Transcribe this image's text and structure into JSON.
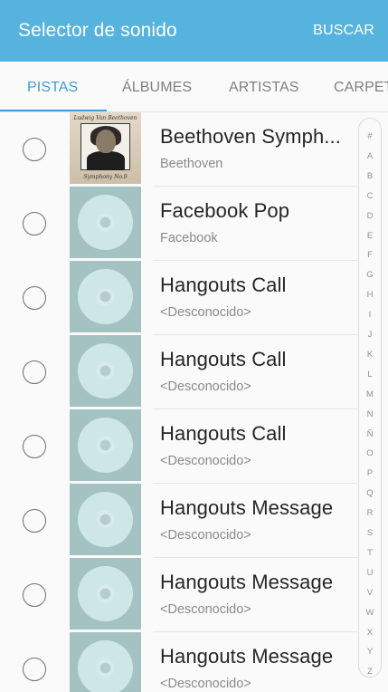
{
  "header": {
    "title": "Selector de sonido",
    "action_label": "BUSCAR"
  },
  "colors": {
    "appbar": "#55b3de",
    "accent": "#3d9dd0"
  },
  "tabs": [
    {
      "label": "PISTAS",
      "active": true
    },
    {
      "label": "ÁLBUMES",
      "active": false
    },
    {
      "label": "ARTISTAS",
      "active": false
    },
    {
      "label": "CARPET",
      "active": false
    }
  ],
  "tracks": [
    {
      "title": "Beethoven Symph...",
      "subtitle": "Beethoven",
      "art": "beethoven-portrait",
      "art_caption_top": "Ludwig Van Beethoven",
      "art_caption_bottom": "Symphony No.9"
    },
    {
      "title": "Facebook Pop",
      "subtitle": "Facebook",
      "art": "disc-icon"
    },
    {
      "title": "Hangouts Call",
      "subtitle": "<Desconocido>",
      "art": "disc-icon"
    },
    {
      "title": "Hangouts Call",
      "subtitle": "<Desconocido>",
      "art": "disc-icon"
    },
    {
      "title": "Hangouts Call",
      "subtitle": "<Desconocido>",
      "art": "disc-icon"
    },
    {
      "title": "Hangouts Message",
      "subtitle": "<Desconocido>",
      "art": "disc-icon"
    },
    {
      "title": "Hangouts Message",
      "subtitle": "<Desconocido>",
      "art": "disc-icon"
    },
    {
      "title": "Hangouts Message",
      "subtitle": "<Desconocido>",
      "art": "disc-icon"
    }
  ],
  "index_letters": [
    "#",
    "A",
    "B",
    "C",
    "D",
    "E",
    "F",
    "G",
    "H",
    "I",
    "J",
    "K",
    "L",
    "M",
    "N",
    "Ñ",
    "O",
    "P",
    "Q",
    "R",
    "S",
    "T",
    "U",
    "V",
    "W",
    "X",
    "Y",
    "Z"
  ]
}
